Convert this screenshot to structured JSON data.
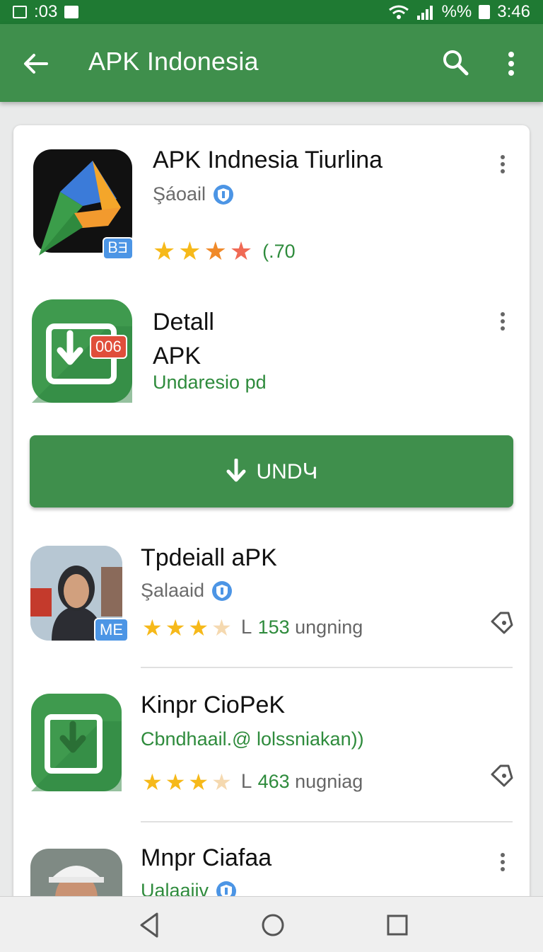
{
  "status": {
    "left_time": ":03",
    "right_text": "%%",
    "clock": "3:46"
  },
  "appbar": {
    "title": "APK Indonesia"
  },
  "items": [
    {
      "title": "APK Indnesia Tiurlina",
      "subtitle": "Şáoail",
      "rating_value": "(.70",
      "badge": "ᏴƎ"
    },
    {
      "title_line1": "Detall",
      "title_line2": "APK",
      "subtitle": "Undaresio pd",
      "badge": "006"
    },
    {
      "title": "Tpdeiall aPK",
      "subtitle": "Şalaaid",
      "count": "153",
      "suffix": "ungning",
      "badge": "ME"
    },
    {
      "title": "Kinpr CioPeK",
      "subtitle": "Cbndhaail.@ lolssniakan))",
      "count": "463",
      "suffix": "nugniag"
    },
    {
      "title": "Mnpr Ciafaa",
      "subtitle": "Ualaaiiv"
    }
  ],
  "download_button": {
    "label": "UNDԿ"
  },
  "colors": {
    "primary": "#3f8f4c",
    "status_bar": "#1f7a33",
    "accent_text": "#2e8b3c",
    "star": "#f6b91a",
    "star_red": "#f06a55"
  }
}
